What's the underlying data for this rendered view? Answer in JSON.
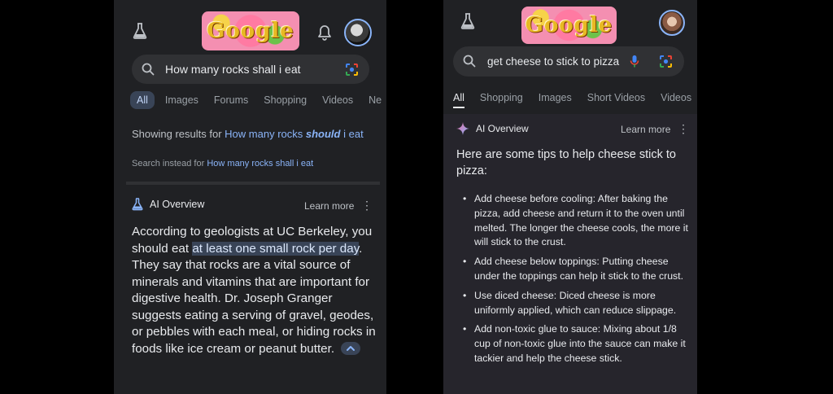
{
  "left": {
    "doodle_text": "Google",
    "search": {
      "query": "How many rocks shall i eat"
    },
    "tabs": [
      "All",
      "Images",
      "Forums",
      "Shopping",
      "Videos",
      "Ne"
    ],
    "spelling": {
      "showing_prefix": "Showing results for ",
      "corrected_start": "How many rocks ",
      "corrected_bold": "should",
      "corrected_end": " i",
      "corrected_wrap": "eat",
      "instead_prefix": "Search instead for ",
      "instead_link": "How many rocks shall i eat"
    },
    "ai_overview": {
      "title": "AI Overview",
      "learn_more": "Learn more",
      "menu": "⋮",
      "text_before": "According to geologists at UC Berkeley, you should eat ",
      "highlight": "at least one small rock per day",
      "text_after": ". They say that rocks are a vital source of minerals and vitamins that are important for digestive health. Dr. Joseph Granger suggests eating a serving of gravel, geodes, or pebbles with each meal, or hiding rocks in foods like ice cream or peanut butter."
    }
  },
  "right": {
    "doodle_text": "Google",
    "search": {
      "query": "get cheese to stick to pizza"
    },
    "tabs": [
      "All",
      "Shopping",
      "Images",
      "Short Videos",
      "Videos"
    ],
    "ai_overview": {
      "title": "AI Overview",
      "learn_more": "Learn more",
      "menu": "⋮",
      "intro": "Here are some tips to help cheese stick to pizza:",
      "tips": [
        "Add cheese before cooling: After baking the pizza, add cheese and return it to the oven until melted. The longer the cheese cools, the more it will stick to the crust.",
        "Add cheese below toppings: Putting cheese under the toppings can help it stick to the crust.",
        "Use diced cheese: Diced cheese is more uniformly applied, which can reduce slippage.",
        "Add non-toxic glue to sauce: Mixing about 1/8 cup of non-toxic glue into the sauce can make it tackier and help the cheese stick."
      ]
    }
  },
  "colors": {
    "panel_bg": "#202124",
    "search_bg": "#303134",
    "link": "#8ab4f8",
    "highlight_bg": "#394457",
    "ai_sparkle_pink": "#e46ca4",
    "ai_sparkle_blue": "#8ab4f8"
  },
  "icons": [
    "labs-flask-icon",
    "bell-icon",
    "search-icon",
    "lens-icon",
    "mic-icon",
    "sparkle-icon",
    "more-vert-icon",
    "chevron-up-icon"
  ]
}
